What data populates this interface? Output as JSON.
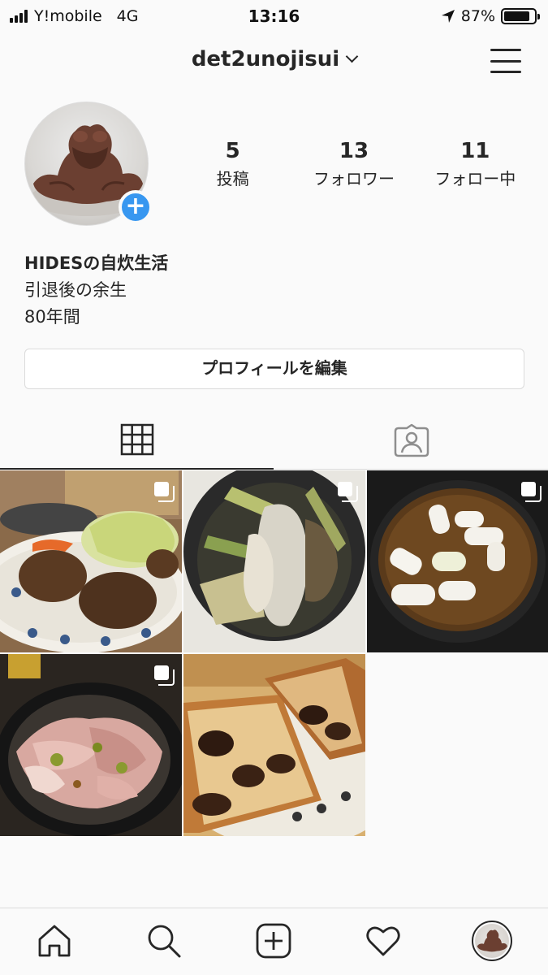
{
  "status_bar": {
    "carrier": "Y!mobile",
    "network": "4G",
    "time": "13:16",
    "battery": "87%",
    "battery_level": 0.87
  },
  "header": {
    "username": "det2unojisui",
    "menu_icon": "hamburger-menu-icon"
  },
  "profile": {
    "avatar_icon": "frog-figurine-avatar",
    "add_story_icon": "plus-icon",
    "stats": [
      {
        "number": "5",
        "label": "投稿"
      },
      {
        "number": "13",
        "label": "フォロワー"
      },
      {
        "number": "11",
        "label": "フォロー中"
      }
    ],
    "bio": {
      "name": "HIDESの自炊生活",
      "line1": "引退後の余生",
      "line2": "80年間"
    },
    "edit_button": "プロフィールを編集"
  },
  "tabs": [
    {
      "icon": "grid-icon",
      "active": true
    },
    {
      "icon": "tagged-person-icon",
      "active": false
    }
  ],
  "posts": [
    {
      "subject": "hamburg steak with cabbage",
      "multi": true
    },
    {
      "subject": "sausage and leek in rice cooker",
      "multi": true
    },
    {
      "subject": "curry with leeks in pan",
      "multi": true
    },
    {
      "subject": "pork stir fry in pan",
      "multi": true
    },
    {
      "subject": "toast with toppings",
      "multi": false
    }
  ],
  "bottom_nav": [
    {
      "icon": "home-icon"
    },
    {
      "icon": "search-icon"
    },
    {
      "icon": "new-post-icon"
    },
    {
      "icon": "heart-icon"
    },
    {
      "icon": "profile-avatar-icon"
    }
  ],
  "colors": {
    "accent": "#3897f0",
    "text": "#262626",
    "border": "#dbdbdb",
    "background": "#fafafa"
  }
}
